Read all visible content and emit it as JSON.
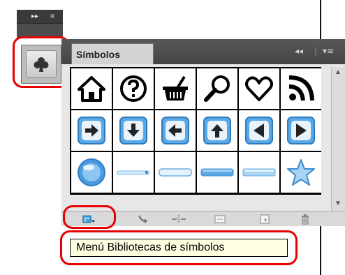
{
  "panel": {
    "title": "Símbolos",
    "collapse_glyph": "◂◂",
    "menu_glyph": "▾≡"
  },
  "dock": {
    "expand_glyph": "▸▸",
    "close_glyph": "×",
    "collapsed_icon": "club-icon"
  },
  "symbols": [
    "house-icon",
    "help-question-icon",
    "shopping-basket-icon",
    "magnifier-icon",
    "heart-icon",
    "rss-feed-icon",
    "arrow-right-button",
    "arrow-down-button",
    "arrow-left-button",
    "arrow-up-button",
    "triangle-left-button",
    "triangle-right-button",
    "blue-orb",
    "slider-bar",
    "capsule-bar-light",
    "capsule-bar-dark",
    "capsule-bar-medium",
    "star-icon"
  ],
  "bottom_bar": {
    "icons": [
      "symbol-libraries-menu-icon",
      "place-symbol-instance-icon",
      "break-link-icon",
      "symbol-options-icon",
      "new-symbol-icon",
      "delete-symbol-icon"
    ]
  },
  "tooltip": {
    "text": "Menú Bibliotecas de símbolos"
  },
  "colors": {
    "highlight": "#e60000",
    "button_blue": "#5aa9e6",
    "tooltip_bg": "#ffffe1"
  }
}
